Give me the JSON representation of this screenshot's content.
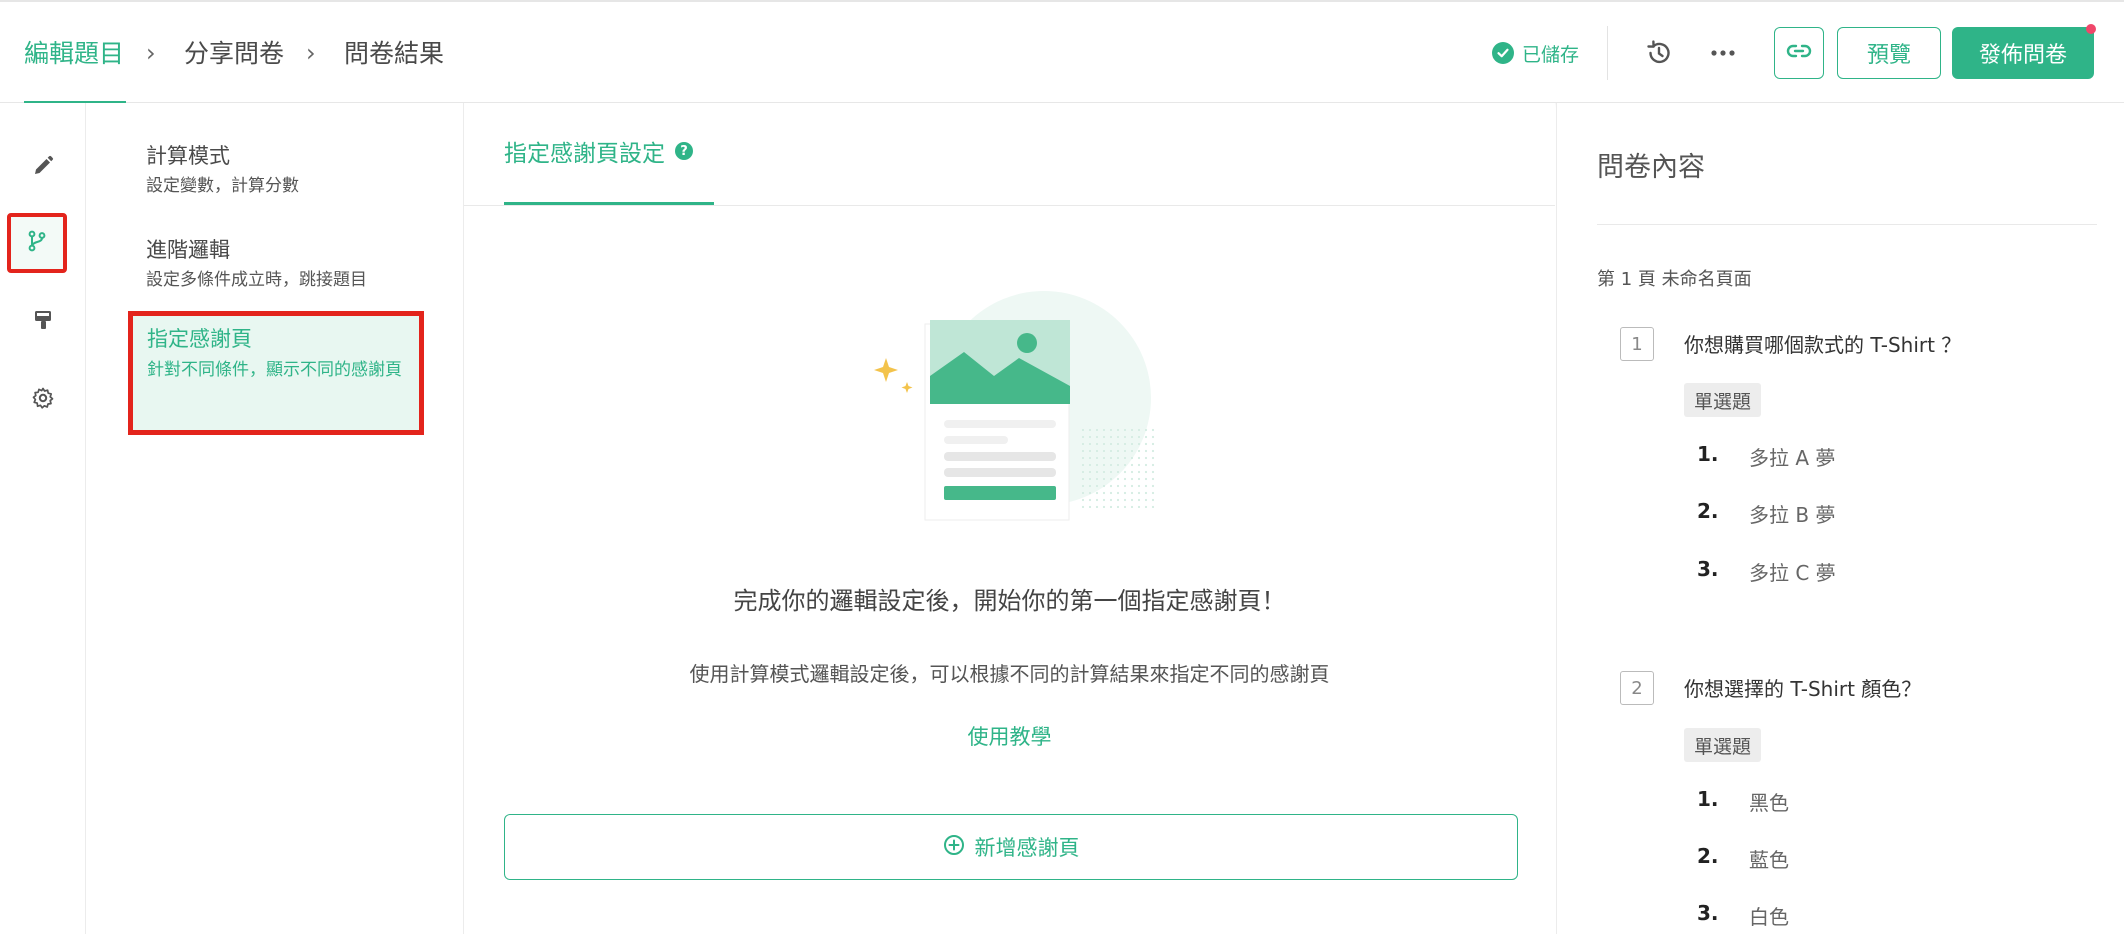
{
  "breadcrumb": {
    "items": [
      "編輯題目",
      "分享問卷",
      "問卷結果"
    ],
    "separator": "›"
  },
  "toolbar": {
    "saved_label": "已儲存",
    "history_icon": "history-icon",
    "more_icon": "more-icon",
    "link_icon": "link-icon",
    "preview_label": "預覽",
    "publish_label": "發佈問卷"
  },
  "rail": {
    "items": [
      {
        "icon": "pencil-icon",
        "selected": false
      },
      {
        "icon": "branch-logic-icon",
        "selected": true
      },
      {
        "icon": "paint-brush-icon",
        "selected": false
      },
      {
        "icon": "gear-icon",
        "selected": false
      }
    ]
  },
  "subnav": {
    "items": [
      {
        "title": "計算模式",
        "desc": "設定變數，計算分數"
      },
      {
        "title": "進階邏輯",
        "desc": "設定多條件成立時，跳接題目"
      },
      {
        "title": "指定感謝頁",
        "desc": "針對不同條件，顯示不同的感謝頁"
      }
    ]
  },
  "main": {
    "tab_label": "指定感謝頁設定",
    "help_glyph": "?",
    "empty_title": "完成你的邏輯設定後，開始你的第一個指定感謝頁！",
    "empty_desc": "使用計算模式邏輯設定後，可以根據不同的計算結果來指定不同的感謝頁",
    "tutorial_link": "使用教學",
    "add_button": "新增感謝頁"
  },
  "right_panel": {
    "title": "問卷內容",
    "page_label": "第 1 頁  未命名頁面",
    "questions": [
      {
        "number": "1",
        "title": "你想購買哪個款式的 T-Shirt ？",
        "type": "單選題",
        "options": [
          {
            "n": "1.",
            "text": "多拉 A 夢"
          },
          {
            "n": "2.",
            "text": "多拉 B 夢"
          },
          {
            "n": "3.",
            "text": "多拉 C 夢"
          }
        ]
      },
      {
        "number": "2",
        "title": "你想選擇的 T-Shirt 顏色？",
        "type": "單選題",
        "options": [
          {
            "n": "1.",
            "text": "黑色"
          },
          {
            "n": "2.",
            "text": "藍色"
          },
          {
            "n": "3.",
            "text": "白色"
          }
        ]
      }
    ]
  },
  "colors": {
    "accent": "#2fb488",
    "highlight_border": "#e3241c",
    "notification_dot": "#f0476a"
  }
}
